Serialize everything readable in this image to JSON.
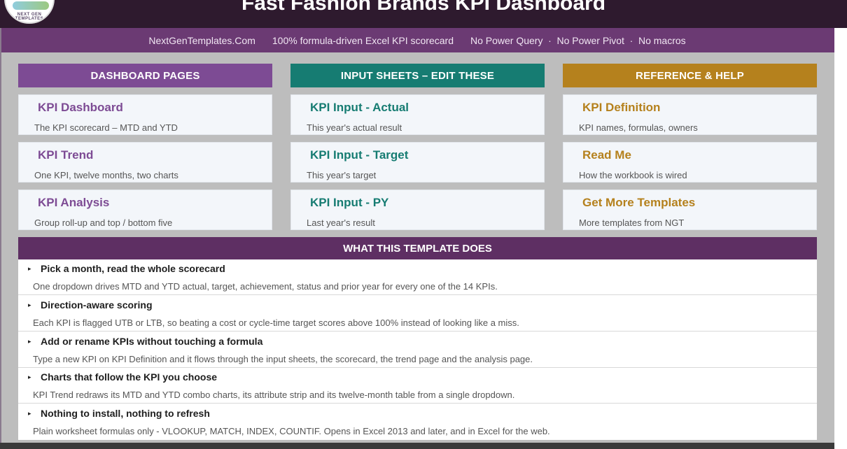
{
  "header": {
    "title": "Fast Fashion Brands KPI Dashboard",
    "logo_text": "NEXT GEN TEMPLATES"
  },
  "subbar": {
    "site": "NextGenTemplates.Com",
    "tagline": "100% formula-driven Excel KPI scorecard",
    "note1": "No Power Query",
    "note2": "No Power Pivot",
    "note3": "No macros",
    "dot": "·"
  },
  "columns": [
    {
      "heading": "DASHBOARD PAGES",
      "cards": [
        {
          "title": "KPI Dashboard",
          "desc": "The KPI scorecard – MTD and YTD"
        },
        {
          "title": "KPI Trend",
          "desc": "One KPI, twelve months, two charts"
        },
        {
          "title": "KPI Analysis",
          "desc": "Group roll-up and top / bottom five"
        }
      ]
    },
    {
      "heading": "INPUT SHEETS – EDIT THESE",
      "cards": [
        {
          "title": "KPI Input - Actual",
          "desc": "This year's actual result"
        },
        {
          "title": "KPI Input - Target",
          "desc": "This year's target"
        },
        {
          "title": "KPI Input - PY",
          "desc": "Last year's result"
        }
      ]
    },
    {
      "heading": "REFERENCE & HELP",
      "cards": [
        {
          "title": "KPI Definition",
          "desc": "KPI names, formulas, owners"
        },
        {
          "title": "Read Me",
          "desc": "How the workbook is wired"
        },
        {
          "title": "Get More Templates",
          "desc": "More templates from NGT"
        }
      ]
    }
  ],
  "what": {
    "heading": "WHAT THIS TEMPLATE DOES",
    "bullet": "▸",
    "features": [
      {
        "title": "Pick a month, read the whole scorecard",
        "desc": "One dropdown drives MTD and YTD actual, target, achievement, status and prior year for every one of the 14 KPIs."
      },
      {
        "title": "Direction-aware scoring",
        "desc": "Each KPI is flagged UTB or LTB, so beating a cost or cycle-time target scores above 100% instead of looking like a miss."
      },
      {
        "title": "Add or rename KPIs without touching a formula",
        "desc": "Type a new KPI on KPI Definition and it flows through the input sheets, the scorecard, the trend page and the analysis page."
      },
      {
        "title": "Charts that follow the KPI you choose",
        "desc": "KPI Trend redraws its MTD and YTD combo charts, its attribute strip and its twelve-month table from a single dropdown."
      },
      {
        "title": "Nothing to install, nothing to refresh",
        "desc": "Plain worksheet formulas only - VLOOKUP, MATCH, INDEX, COUNTIF. Opens in Excel 2013 and later, and in Excel for the web."
      }
    ]
  },
  "colors": {
    "header_bg": "#2e1a2e",
    "subbar_bg": "#6b3a73",
    "purple": "#7d4b94",
    "teal": "#167c72",
    "gold": "#b5811d",
    "what_head_bg": "#5e2f63"
  }
}
